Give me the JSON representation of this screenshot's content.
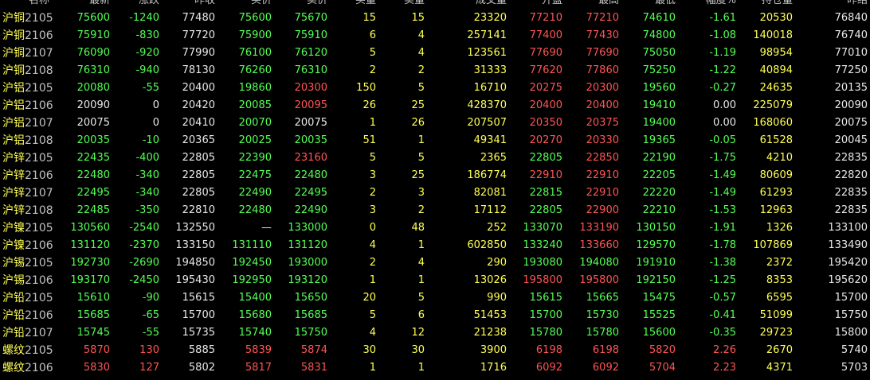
{
  "headers": [
    "名称",
    "最新",
    "涨跌",
    "昨收",
    "买价",
    "卖价",
    "买量",
    "卖量",
    "成交量",
    "开盘",
    "最高",
    "最低",
    "幅度%",
    "持仓量",
    "昨结"
  ],
  "rows": [
    {
      "sym": "沪铜",
      "mon": "2105",
      "last": "75600",
      "chg": "-1240",
      "prev": "77480",
      "bid": "75600",
      "ask": "75670",
      "bidv": "15",
      "askv": "15",
      "vol": "23320",
      "open": "77210",
      "high": "77210",
      "low": "74610",
      "pct": "-1.61",
      "oi": "20530",
      "settle": "76840"
    },
    {
      "sym": "沪铜",
      "mon": "2106",
      "last": "75910",
      "chg": "-830",
      "prev": "77720",
      "bid": "75900",
      "ask": "75910",
      "bidv": "6",
      "askv": "4",
      "vol": "257141",
      "open": "77400",
      "high": "77430",
      "low": "74800",
      "pct": "-1.08",
      "oi": "140018",
      "settle": "76740"
    },
    {
      "sym": "沪铜",
      "mon": "2107",
      "last": "76090",
      "chg": "-920",
      "prev": "77990",
      "bid": "76100",
      "ask": "76120",
      "bidv": "5",
      "askv": "4",
      "vol": "123561",
      "open": "77690",
      "high": "77690",
      "low": "75050",
      "pct": "-1.19",
      "oi": "98954",
      "settle": "77010"
    },
    {
      "sym": "沪铜",
      "mon": "2108",
      "last": "76310",
      "chg": "-940",
      "prev": "78130",
      "bid": "76260",
      "ask": "76310",
      "bidv": "2",
      "askv": "2",
      "vol": "31333",
      "open": "77620",
      "high": "77860",
      "low": "75250",
      "pct": "-1.22",
      "oi": "40894",
      "settle": "77250"
    },
    {
      "sym": "沪铝",
      "mon": "2105",
      "last": "20080",
      "chg": "-55",
      "prev": "20400",
      "bid": "19860",
      "ask": "20300",
      "bidv": "150",
      "askv": "5",
      "vol": "16710",
      "open": "20275",
      "high": "20300",
      "low": "19560",
      "pct": "-0.27",
      "oi": "24635",
      "settle": "20135"
    },
    {
      "sym": "沪铝",
      "mon": "2106",
      "last": "20090",
      "chg": "0",
      "prev": "20420",
      "bid": "20085",
      "ask": "20095",
      "bidv": "26",
      "askv": "25",
      "vol": "428370",
      "open": "20400",
      "high": "20400",
      "low": "19410",
      "pct": "0.00",
      "oi": "225079",
      "settle": "20090"
    },
    {
      "sym": "沪铝",
      "mon": "2107",
      "last": "20075",
      "chg": "0",
      "prev": "20410",
      "bid": "20070",
      "ask": "20075",
      "bidv": "1",
      "askv": "26",
      "vol": "207507",
      "open": "20350",
      "high": "20375",
      "low": "19400",
      "pct": "0.00",
      "oi": "168060",
      "settle": "20075"
    },
    {
      "sym": "沪铝",
      "mon": "2108",
      "last": "20035",
      "chg": "-10",
      "prev": "20365",
      "bid": "20025",
      "ask": "20035",
      "bidv": "51",
      "askv": "1",
      "vol": "49341",
      "open": "20270",
      "high": "20330",
      "low": "19365",
      "pct": "-0.05",
      "oi": "61528",
      "settle": "20045"
    },
    {
      "sym": "沪锌",
      "mon": "2105",
      "last": "22435",
      "chg": "-400",
      "prev": "22805",
      "bid": "22390",
      "ask": "23160",
      "bidv": "5",
      "askv": "5",
      "vol": "2365",
      "open": "22805",
      "high": "22850",
      "low": "22190",
      "pct": "-1.75",
      "oi": "4210",
      "settle": "22835"
    },
    {
      "sym": "沪锌",
      "mon": "2106",
      "last": "22480",
      "chg": "-340",
      "prev": "22805",
      "bid": "22475",
      "ask": "22480",
      "bidv": "3",
      "askv": "25",
      "vol": "186774",
      "open": "22910",
      "high": "22910",
      "low": "22205",
      "pct": "-1.49",
      "oi": "80609",
      "settle": "22820"
    },
    {
      "sym": "沪锌",
      "mon": "2107",
      "last": "22495",
      "chg": "-340",
      "prev": "22805",
      "bid": "22490",
      "ask": "22495",
      "bidv": "2",
      "askv": "3",
      "vol": "82081",
      "open": "22815",
      "high": "22910",
      "low": "22220",
      "pct": "-1.49",
      "oi": "61293",
      "settle": "22835"
    },
    {
      "sym": "沪锌",
      "mon": "2108",
      "last": "22485",
      "chg": "-350",
      "prev": "22810",
      "bid": "22480",
      "ask": "22490",
      "bidv": "3",
      "askv": "2",
      "vol": "17112",
      "open": "22805",
      "high": "22900",
      "low": "22210",
      "pct": "-1.53",
      "oi": "12963",
      "settle": "22835"
    },
    {
      "sym": "沪镍",
      "mon": "2105",
      "last": "130560",
      "chg": "-2540",
      "prev": "132550",
      "bid": "—",
      "ask": "133000",
      "bidv": "0",
      "askv": "48",
      "vol": "252",
      "open": "133070",
      "high": "133190",
      "low": "130150",
      "pct": "-1.91",
      "oi": "1326",
      "settle": "133100"
    },
    {
      "sym": "沪镍",
      "mon": "2106",
      "last": "131120",
      "chg": "-2370",
      "prev": "133150",
      "bid": "131110",
      "ask": "131120",
      "bidv": "4",
      "askv": "1",
      "vol": "602850",
      "open": "133240",
      "high": "133660",
      "low": "129570",
      "pct": "-1.78",
      "oi": "107869",
      "settle": "133490"
    },
    {
      "sym": "沪锡",
      "mon": "2105",
      "last": "192730",
      "chg": "-2690",
      "prev": "194850",
      "bid": "192450",
      "ask": "193000",
      "bidv": "2",
      "askv": "4",
      "vol": "290",
      "open": "193080",
      "high": "194080",
      "low": "191910",
      "pct": "-1.38",
      "oi": "2372",
      "settle": "195420"
    },
    {
      "sym": "沪锡",
      "mon": "2106",
      "last": "193170",
      "chg": "-2450",
      "prev": "195430",
      "bid": "192950",
      "ask": "193120",
      "bidv": "1",
      "askv": "1",
      "vol": "13026",
      "open": "195800",
      "high": "195800",
      "low": "192150",
      "pct": "-1.25",
      "oi": "8353",
      "settle": "195620"
    },
    {
      "sym": "沪铅",
      "mon": "2105",
      "last": "15610",
      "chg": "-90",
      "prev": "15615",
      "bid": "15400",
      "ask": "15650",
      "bidv": "20",
      "askv": "5",
      "vol": "990",
      "open": "15615",
      "high": "15665",
      "low": "15475",
      "pct": "-0.57",
      "oi": "6595",
      "settle": "15700"
    },
    {
      "sym": "沪铅",
      "mon": "2106",
      "last": "15685",
      "chg": "-65",
      "prev": "15700",
      "bid": "15680",
      "ask": "15685",
      "bidv": "5",
      "askv": "6",
      "vol": "51453",
      "open": "15700",
      "high": "15730",
      "low": "15525",
      "pct": "-0.41",
      "oi": "51099",
      "settle": "15750"
    },
    {
      "sym": "沪铅",
      "mon": "2107",
      "last": "15745",
      "chg": "-55",
      "prev": "15735",
      "bid": "15740",
      "ask": "15750",
      "bidv": "4",
      "askv": "12",
      "vol": "21238",
      "open": "15780",
      "high": "15780",
      "low": "15600",
      "pct": "-0.35",
      "oi": "29723",
      "settle": "15800"
    },
    {
      "sym": "螺纹",
      "mon": "2105",
      "last": "5870",
      "chg": "130",
      "prev": "5885",
      "bid": "5839",
      "ask": "5874",
      "bidv": "30",
      "askv": "30",
      "vol": "3900",
      "open": "6198",
      "high": "6198",
      "low": "5820",
      "pct": "2.26",
      "oi": "2670",
      "settle": "5740"
    },
    {
      "sym": "螺纹",
      "mon": "2106",
      "last": "5830",
      "chg": "127",
      "prev": "5802",
      "bid": "5817",
      "ask": "5831",
      "bidv": "1",
      "askv": "1",
      "vol": "1716",
      "open": "6092",
      "high": "6092",
      "low": "5704",
      "pct": "2.23",
      "oi": "4371",
      "settle": "5703"
    }
  ],
  "colors": {
    "up": "#ff5454",
    "down": "#54ff54",
    "flat": "#e8e8e8",
    "yellow": "#ffff54",
    "header": "#c0c0c0",
    "background": "#000000"
  }
}
